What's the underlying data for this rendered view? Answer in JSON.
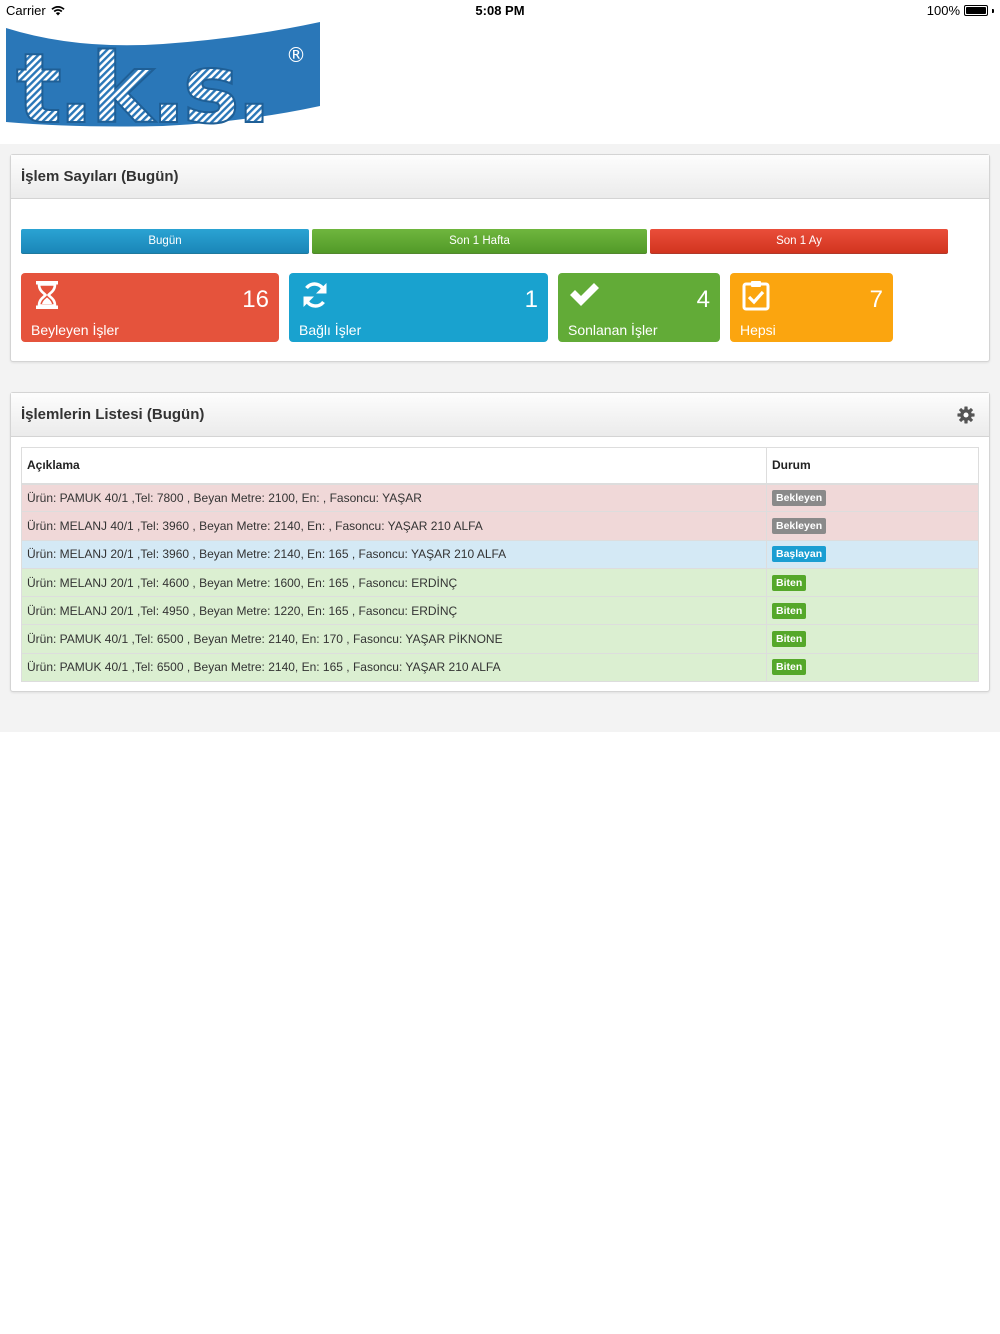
{
  "status_bar": {
    "carrier": "Carrier",
    "time": "5:08 PM",
    "battery": "100%"
  },
  "logo": {
    "text": "t.k.s.",
    "mark": "®",
    "color": "#2a77b8"
  },
  "counts_panel": {
    "title": "İşlem Sayıları (Bugün)",
    "ranges": [
      {
        "label": "Bugün",
        "color": "#1a90c4"
      },
      {
        "label": "Son 1 Hafta",
        "color": "#5ea531"
      },
      {
        "label": "Son 1 Ay",
        "color": "#dc3f2a"
      }
    ],
    "tiles": [
      {
        "icon": "hourglass-icon",
        "value": "16",
        "label": "Beyleyen İşler",
        "color": "#e5533c"
      },
      {
        "icon": "refresh-icon",
        "value": "1",
        "label": "Bağlı İşler",
        "color": "#19a2cf"
      },
      {
        "icon": "checkmark-icon",
        "value": "4",
        "label": "Sonlanan İşler",
        "color": "#62ab37"
      },
      {
        "icon": "clipboard-check-icon",
        "value": "7",
        "label": "Hepsi",
        "color": "#fba50f"
      }
    ]
  },
  "list_panel": {
    "title": "İşlemlerin Listesi (Bugün)",
    "settings_icon": "gear-icon",
    "columns": [
      "Açıklama",
      "Durum"
    ],
    "rows": [
      {
        "description": "Ürün: PAMUK 40/1 ,Tel: 7800 , Beyan Metre: 2100, En: , Fasoncu: YAŞAR",
        "status": "Bekleyen"
      },
      {
        "description": "Ürün: MELANJ 40/1 ,Tel: 3960 , Beyan Metre: 2140, En: , Fasoncu: YAŞAR 210 ALFA",
        "status": "Bekleyen"
      },
      {
        "description": "Ürün: MELANJ 20/1 ,Tel: 3960 , Beyan Metre: 2140, En: 165 , Fasoncu: YAŞAR 210 ALFA",
        "status": "Başlayan"
      },
      {
        "description": "Ürün: MELANJ 20/1 ,Tel: 4600 , Beyan Metre: 1600, En: 165 , Fasoncu: ERDİNÇ",
        "status": "Biten"
      },
      {
        "description": "Ürün: MELANJ 20/1 ,Tel: 4950 , Beyan Metre: 1220, En: 165 , Fasoncu: ERDİNÇ",
        "status": "Biten"
      },
      {
        "description": "Ürün: PAMUK 40/1 ,Tel: 6500 , Beyan Metre: 2140, En: 170 , Fasoncu: YAŞAR PİKNONE",
        "status": "Biten"
      },
      {
        "description": "Ürün: PAMUK 40/1 ,Tel: 6500 , Beyan Metre: 2140, En: 165 , Fasoncu: YAŞAR 210 ALFA",
        "status": "Biten"
      }
    ]
  }
}
